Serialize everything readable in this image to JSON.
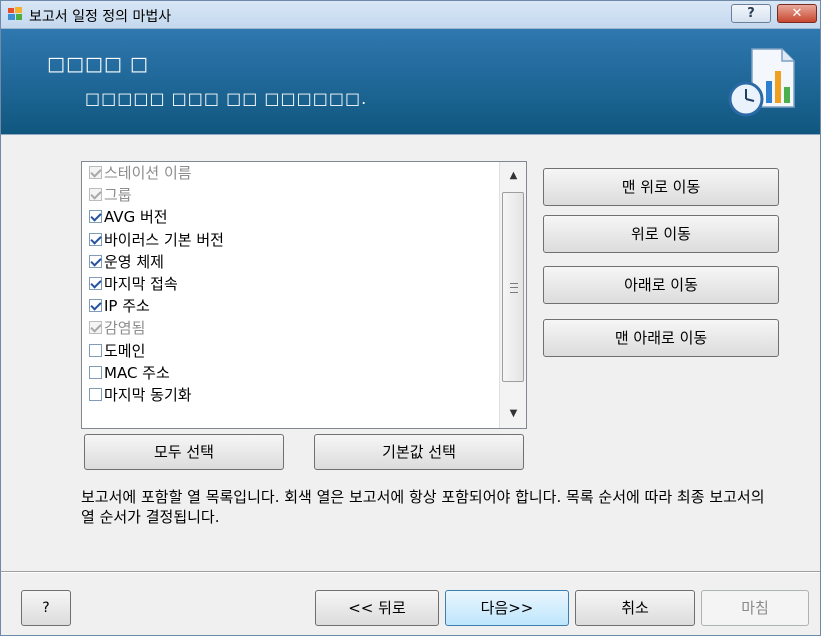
{
  "window": {
    "title": "보고서 일정 정의 마법사",
    "help_glyph": "?",
    "close_glyph": "✕"
  },
  "header": {
    "title": "□□□□ □",
    "subtitle": "□□□□□ □□□ □□ □□□□□□."
  },
  "columns": {
    "items": [
      {
        "label": "스테이션 이름",
        "checked": true,
        "disabled": true
      },
      {
        "label": "그룹",
        "checked": true,
        "disabled": true
      },
      {
        "label": "AVG 버전",
        "checked": true,
        "disabled": false
      },
      {
        "label": "바이러스 기본 버전",
        "checked": true,
        "disabled": false
      },
      {
        "label": "운영 체제",
        "checked": true,
        "disabled": false
      },
      {
        "label": "마지막 접속",
        "checked": true,
        "disabled": false
      },
      {
        "label": "IP 주소",
        "checked": true,
        "disabled": false
      },
      {
        "label": "감염됨",
        "checked": true,
        "disabled": true
      },
      {
        "label": "도메인",
        "checked": false,
        "disabled": false
      },
      {
        "label": "MAC 주소",
        "checked": false,
        "disabled": false
      },
      {
        "label": "마지막 동기화",
        "checked": false,
        "disabled": false
      }
    ]
  },
  "scrollbar": {
    "up_glyph": "▲",
    "down_glyph": "▼"
  },
  "move_buttons": {
    "move_top": "맨 위로 이동",
    "move_up": "위로 이동",
    "move_down": "아래로 이동",
    "move_bottom": "맨 아래로 이동"
  },
  "select_buttons": {
    "select_all": "모두 선택",
    "select_default": "기본값 선택"
  },
  "description": "보고서에 포함할 열 목록입니다. 회색 열은 보고서에 항상 포함되어야 합니다. 목록 순서에 따라 최종 보고서의 열 순서가 결정됩니다.",
  "footer": {
    "help": "?",
    "back": "<< 뒤로",
    "next": "다음>>",
    "cancel": "취소",
    "finish": "마침"
  }
}
